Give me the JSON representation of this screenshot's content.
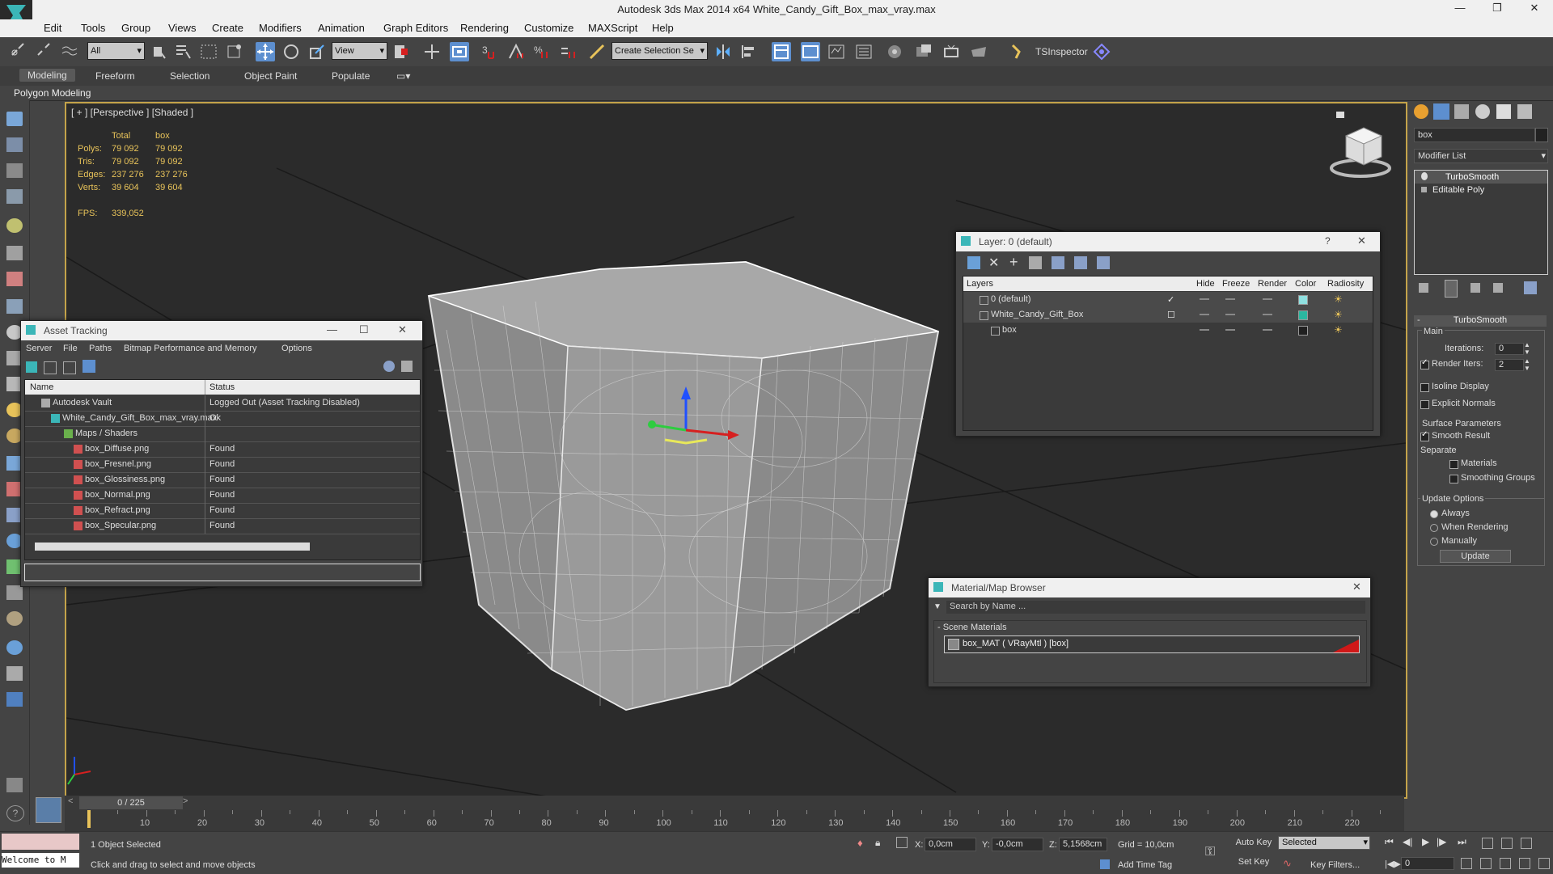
{
  "window": {
    "title": "Autodesk 3ds Max  2014 x64     White_Candy_Gift_Box_max_vray.max"
  },
  "menu": [
    "Edit",
    "Tools",
    "Group",
    "Views",
    "Create",
    "Modifiers",
    "Animation",
    "Graph Editors",
    "Rendering",
    "Customize",
    "MAXScript",
    "Help"
  ],
  "toolbar": {
    "filter": "All",
    "coord": "View",
    "selection_set": "Create Selection Se",
    "tsinspector": "TSInspector"
  },
  "ribbon": {
    "tabs": [
      "Modeling",
      "Freeform",
      "Selection",
      "Object Paint",
      "Populate"
    ],
    "active": "Modeling",
    "sub": "Polygon Modeling"
  },
  "viewport": {
    "label": "[ + ] [Perspective ] [Shaded ]",
    "stats": {
      "head_total": "Total",
      "head_obj": "box",
      "rows": [
        {
          "k": "Polys:",
          "t": "79 092",
          "o": "79 092"
        },
        {
          "k": "Tris:",
          "t": "79 092",
          "o": "79 092"
        },
        {
          "k": "Edges:",
          "t": "237 276",
          "o": "237 276"
        },
        {
          "k": "Verts:",
          "t": "39 604",
          "o": "39 604"
        }
      ],
      "fps_k": "FPS:",
      "fps_v": "339,052"
    }
  },
  "asset_tracking": {
    "title": "Asset Tracking",
    "menu": [
      "Server",
      "File",
      "Paths",
      "Bitmap Performance and Memory",
      "Options"
    ],
    "col_name": "Name",
    "col_status": "Status",
    "rows": [
      {
        "name": "Autodesk Vault",
        "status": "Logged Out (Asset Tracking Disabled)"
      },
      {
        "name": "White_Candy_Gift_Box_max_vray.max",
        "status": "Ok"
      },
      {
        "name": "Maps / Shaders",
        "status": ""
      },
      {
        "name": "box_Diffuse.png",
        "status": "Found"
      },
      {
        "name": "box_Fresnel.png",
        "status": "Found"
      },
      {
        "name": "box_Glossiness.png",
        "status": "Found"
      },
      {
        "name": "box_Normal.png",
        "status": "Found"
      },
      {
        "name": "box_Refract.png",
        "status": "Found"
      },
      {
        "name": "box_Specular.png",
        "status": "Found"
      }
    ]
  },
  "layer": {
    "title": "Layer: 0 (default)",
    "help": "?",
    "cols": [
      "Layers",
      "Hide",
      "Freeze",
      "Render",
      "Color",
      "Radiosity"
    ],
    "rows": [
      {
        "name": "0 (default)",
        "color": "#8fe0e0"
      },
      {
        "name": "White_Candy_Gift_Box",
        "color": "#2ab8a0"
      },
      {
        "name": "box",
        "color": "#202020"
      }
    ]
  },
  "material": {
    "title": "Material/Map Browser",
    "search_placeholder": "Search by Name ...",
    "group": "- Scene Materials",
    "item": "box_MAT  ( VRayMtl )  [box]"
  },
  "cmdpanel": {
    "object_name": "box",
    "modifier_list": "Modifier List",
    "stack": [
      "TurboSmooth",
      "Editable Poly"
    ],
    "turbo": {
      "title": "TurboSmooth",
      "main": "Main",
      "iterations_label": "Iterations:",
      "iterations": "0",
      "render_iters_label": "Render Iters:",
      "render_iters": "2",
      "isoline": "Isoline Display",
      "explicit": "Explicit Normals",
      "surface": "Surface Parameters",
      "smooth": "Smooth Result",
      "separate": "Separate",
      "materials": "Materials",
      "smoothing": "Smoothing Groups",
      "update_options": "Update Options",
      "always": "Always",
      "when_rendering": "When Rendering",
      "manually": "Manually",
      "update_btn": "Update"
    }
  },
  "timeline": {
    "frame": "0 / 225",
    "ticks": [
      "10",
      "20",
      "30",
      "40",
      "50",
      "60",
      "70",
      "80",
      "90",
      "100",
      "110",
      "120",
      "130",
      "140",
      "150",
      "160",
      "170",
      "180",
      "190",
      "200",
      "210",
      "220"
    ]
  },
  "status": {
    "welcome": "Welcome to M",
    "selected": "1 Object Selected",
    "hint": "Click and drag to select and move objects",
    "x_label": "X:",
    "x": "0,0cm",
    "y_label": "Y:",
    "y": "-0,0cm",
    "z_label": "Z:",
    "z": "5,1568cm",
    "grid": "Grid = 10,0cm",
    "add_time_tag": "Add Time Tag",
    "auto_key": "Auto Key",
    "set_key": "Set Key",
    "selected_dd": "Selected",
    "key_filters": "Key Filters...",
    "frame": "0"
  },
  "colors": {
    "accent": "#c4a34a",
    "stat": "#e8c35a",
    "axis_x": "#d62020",
    "axis_y": "#2ecc40",
    "axis_z": "#2050ff",
    "mat_swatch": "#d01818"
  }
}
